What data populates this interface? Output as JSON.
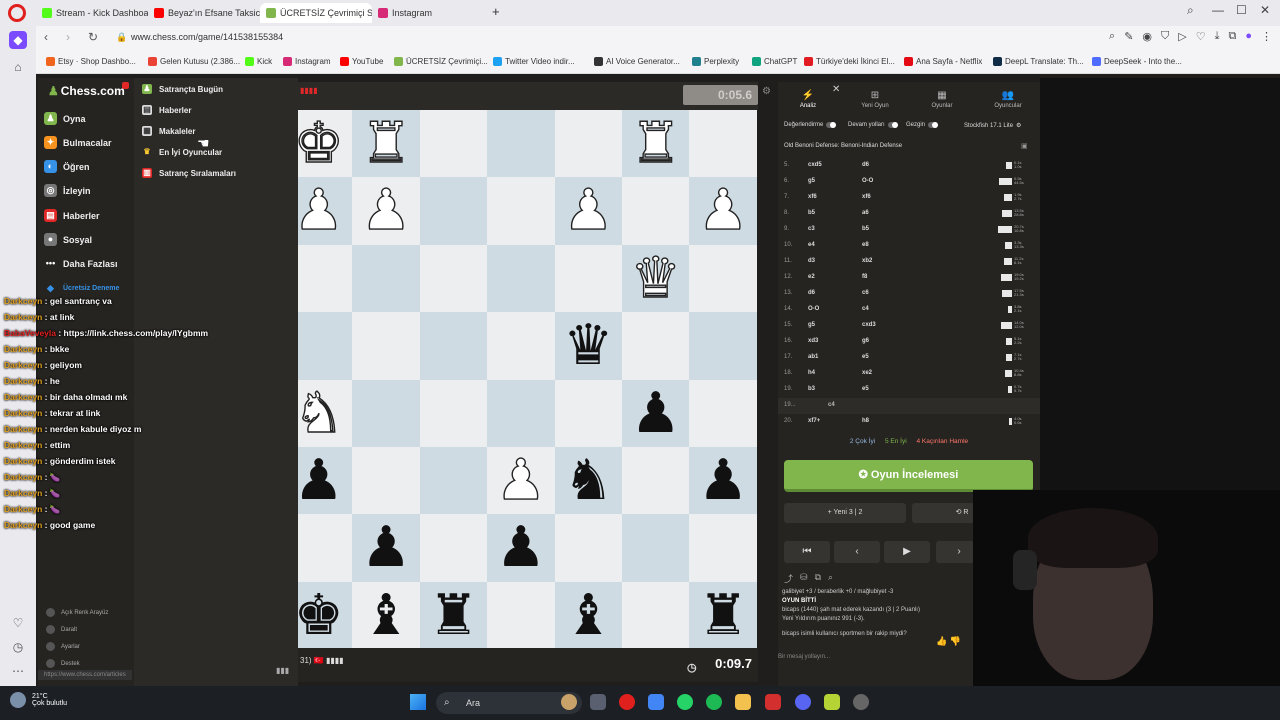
{
  "browser": {
    "tabs": [
      {
        "label": "Stream - Kick Dashboard",
        "color": "#53fc18"
      },
      {
        "label": "Beyaz'ın Efsane Taksici An",
        "color": "#ff0000"
      },
      {
        "label": "ÜCRETSİZ Çevrimiçi Satra",
        "color": "#81b64c"
      },
      {
        "label": "Instagram",
        "color": "#d62976"
      }
    ],
    "url": "www.chess.com/game/141538155384",
    "bookmarks": [
      {
        "label": "Etsy · Shop Dashbo...",
        "color": "#f1641e"
      },
      {
        "label": "Gelen Kutusu (2.386...",
        "color": "#ea4335"
      },
      {
        "label": "Kick",
        "color": "#53fc18"
      },
      {
        "label": "Instagram",
        "color": "#d62976"
      },
      {
        "label": "YouTube",
        "color": "#ff0000"
      },
      {
        "label": "ÜCRETSİZ Çevrimiçi...",
        "color": "#81b64c"
      },
      {
        "label": "Twitter Video indir...",
        "color": "#1da1f2"
      },
      {
        "label": "AI Voice Generator...",
        "color": "#333333"
      },
      {
        "label": "Perplexity",
        "color": "#20808d"
      },
      {
        "label": "ChatGPT",
        "color": "#10a37f"
      },
      {
        "label": "Türkiye'deki İkinci El...",
        "color": "#e21b22"
      },
      {
        "label": "Ana Sayfa - Netflix",
        "color": "#e50914"
      },
      {
        "label": "DeepL Translate: Th...",
        "color": "#0f2b46"
      },
      {
        "label": "DeepSeek - Into the...",
        "color": "#4d6bfe"
      }
    ]
  },
  "sidebar": {
    "logo": "Chess.com",
    "items": [
      {
        "label": "Oyna",
        "color": "#81b64c"
      },
      {
        "label": "Bulmacalar",
        "color": "#f7931e"
      },
      {
        "label": "Öğren",
        "color": "#3692e7"
      },
      {
        "label": "İzleyin",
        "color": "#bbbbbb"
      },
      {
        "label": "Haberler",
        "color": "#e02828"
      },
      {
        "label": "Sosyal",
        "color": "#bbbbbb"
      },
      {
        "label": "Daha Fazlası",
        "color": "#bbbbbb"
      },
      {
        "label": "Ücretsiz Deneme",
        "color": "#3692e7"
      }
    ],
    "bottom": [
      "Açık Renk Arayüz",
      "Daralt",
      "Ayarlar",
      "Destek"
    ],
    "status_url": "https://www.chess.com/articles"
  },
  "submenu": {
    "items": [
      {
        "label": "Satrançta Bugün",
        "color": "#81b64c"
      },
      {
        "label": "Haberler",
        "color": "#dddddd"
      },
      {
        "label": "Makaleler",
        "color": "#dddddd"
      },
      {
        "label": "En İyi Oyuncular",
        "color": "#f7c631"
      },
      {
        "label": "Satranç Sıralamaları",
        "color": "#e02828"
      }
    ]
  },
  "chat": {
    "messages": [
      {
        "user": "Darkceyn",
        "text": "gel santranç va"
      },
      {
        "user": "Darkceyn",
        "text": "at link"
      },
      {
        "user": "BabaVeveyla",
        "text": "https://link.chess.com/play/lYgbmm",
        "highlight": true
      },
      {
        "user": "Darkceyn",
        "text": "bkke"
      },
      {
        "user": "Darkceyn",
        "text": "geliyom"
      },
      {
        "user": "Darkceyn",
        "text": "he"
      },
      {
        "user": "Darkceyn",
        "text": "bir daha olmadı mk"
      },
      {
        "user": "Darkceyn",
        "text": "tekrar at link"
      },
      {
        "user": "Darkceyn",
        "text": "nerden kabule diyoz m"
      },
      {
        "user": "Darkceyn",
        "text": "ettim"
      },
      {
        "user": "Darkceyn",
        "text": "gönderdim istek"
      },
      {
        "user": "Darkceyn",
        "text": "🍆"
      },
      {
        "user": "Darkceyn",
        "text": "🍆"
      },
      {
        "user": "Darkceyn",
        "text": "🍆"
      },
      {
        "user": "Darkceyn",
        "text": "good game"
      }
    ],
    "separator": " : "
  },
  "board": {
    "top_clock": "0:05.6",
    "bottom_clock": "0:09.7",
    "bottom_player": "31) 🇹🇷 ▮▮▮▮",
    "pieces": [
      {
        "sq": [
          0,
          0
        ],
        "p": "♚",
        "c": "w"
      },
      {
        "sq": [
          1,
          0
        ],
        "p": "♜",
        "c": "w"
      },
      {
        "sq": [
          5,
          0
        ],
        "p": "♜",
        "c": "w"
      },
      {
        "sq": [
          0,
          1
        ],
        "p": "♟",
        "c": "w"
      },
      {
        "sq": [
          1,
          1
        ],
        "p": "♟",
        "c": "w"
      },
      {
        "sq": [
          4,
          1
        ],
        "p": "♟",
        "c": "w"
      },
      {
        "sq": [
          6,
          1
        ],
        "p": "♟",
        "c": "w"
      },
      {
        "sq": [
          5,
          2
        ],
        "p": "♛",
        "c": "w"
      },
      {
        "sq": [
          4,
          3
        ],
        "p": "♛",
        "c": "b"
      },
      {
        "sq": [
          0,
          4
        ],
        "p": "♞",
        "c": "w"
      },
      {
        "sq": [
          5,
          4
        ],
        "p": "♟",
        "c": "b"
      },
      {
        "sq": [
          0,
          5
        ],
        "p": "♟",
        "c": "b"
      },
      {
        "sq": [
          3,
          5
        ],
        "p": "♟",
        "c": "w"
      },
      {
        "sq": [
          4,
          5
        ],
        "p": "♞",
        "c": "b"
      },
      {
        "sq": [
          6,
          5
        ],
        "p": "♟",
        "c": "b"
      },
      {
        "sq": [
          1,
          6
        ],
        "p": "♟",
        "c": "b"
      },
      {
        "sq": [
          3,
          6
        ],
        "p": "♟",
        "c": "b"
      },
      {
        "sq": [
          0,
          7
        ],
        "p": "♚",
        "c": "b"
      },
      {
        "sq": [
          1,
          7
        ],
        "p": "♝",
        "c": "b"
      },
      {
        "sq": [
          2,
          7
        ],
        "p": "♜",
        "c": "b"
      },
      {
        "sq": [
          4,
          7
        ],
        "p": "♝",
        "c": "b"
      },
      {
        "sq": [
          6,
          7
        ],
        "p": "♜",
        "c": "b"
      }
    ]
  },
  "panel": {
    "tabs": [
      "Analiz",
      "Yeni Oyun",
      "Oyunlar",
      "Oyuncular"
    ],
    "options": [
      "Değerlendirme",
      "Devam yolları",
      "Gezgin",
      "Stockfish 17.1 Lite"
    ],
    "opening": "Old Benoni Defense: Benoni-Indian Defense",
    "moves": [
      {
        "n": "5.",
        "w": "cxd5",
        "b": "d6",
        "bar": 0.4,
        "t": [
          "0.1s",
          "1.0s"
        ]
      },
      {
        "n": "6.",
        "w": "g5",
        "b": "O-O",
        "bar": 0.9,
        "t": [
          "0.5s",
          "44.5s"
        ]
      },
      {
        "n": "7.",
        "w": "xf6",
        "b": "xf6",
        "bar": 0.6,
        "t": [
          "1.9s",
          "2.7s"
        ]
      },
      {
        "n": "8.",
        "w": "b5",
        "b": "a6",
        "bar": 0.7,
        "t": [
          "13.5s",
          "28.8s"
        ]
      },
      {
        "n": "9.",
        "w": "c3",
        "b": "b5",
        "bar": 1.0,
        "t": [
          "20.7s",
          "16.8s"
        ]
      },
      {
        "n": "10.",
        "w": "e4",
        "b": "e8",
        "bar": 0.5,
        "t": [
          "3.3s",
          "13.3s"
        ]
      },
      {
        "n": "11.",
        "w": "d3",
        "b": "xb2",
        "bar": 0.6,
        "t": [
          "11.2s",
          "6.1s"
        ]
      },
      {
        "n": "12.",
        "w": "e2",
        "b": "f8",
        "bar": 0.8,
        "t": [
          "19.0s",
          "19.2s"
        ]
      },
      {
        "n": "13.",
        "w": "d6",
        "b": "c6",
        "bar": 0.7,
        "t": [
          "17.5s",
          "21.3s"
        ]
      },
      {
        "n": "14.",
        "w": "O-O",
        "b": "c4",
        "bar": 0.3,
        "t": [
          "3.8s",
          "2.1s"
        ]
      },
      {
        "n": "15.",
        "w": "g5",
        "b": "cxd3",
        "bar": 0.8,
        "t": [
          "14.0s",
          "12.0s"
        ]
      },
      {
        "n": "16.",
        "w": "xd3",
        "b": "g6",
        "bar": 0.4,
        "t": [
          "5.1s",
          "2.2s"
        ]
      },
      {
        "n": "17.",
        "w": "ab1",
        "b": "e5",
        "bar": 0.4,
        "t": [
          "7.1s",
          "2.7s"
        ]
      },
      {
        "n": "18.",
        "w": "h4",
        "b": "xe2",
        "bar": 0.5,
        "t": [
          "10.4s",
          "8.8s"
        ]
      },
      {
        "n": "19.",
        "w": "b3",
        "b": "e5",
        "bar": 0.3,
        "t": [
          "0.7s",
          "5.7s"
        ]
      },
      {
        "n": "19...",
        "w": "c4",
        "b": "",
        "bar": 0,
        "t": [
          "",
          ""
        ],
        "var": true
      },
      {
        "n": "20.",
        "w": "xf7+",
        "b": "h8",
        "bar": 0.2,
        "t": [
          "4.0s",
          "0.6s"
        ]
      }
    ],
    "summary": {
      "best": "2 Çok İyi",
      "great": "5 En İyi",
      "missed": "4 Kaçırılan Hamle"
    },
    "review_button": "Oyun İncelemesi",
    "new_btn": "Yeni 3 | 2",
    "rematch_btn": "R",
    "result": {
      "prev": "galibiyet +3 / beraberlik +0 / mağlubiyet -3",
      "title": "OYUN BİTTİ",
      "line1": "bicaps (1440) şah mat ederek kazandı (3 | 2 Puanlı)",
      "line2": "Yeni Yıldırım puanınız 991 (-3).",
      "line3": "bicaps isimli kullanıcı sportmen bir rakip miydi?"
    },
    "message_placeholder": "Bir mesaj yollayın..."
  },
  "taskbar": {
    "temp": "21°C",
    "weather": "Çok bulutlu",
    "search": "Ara"
  }
}
